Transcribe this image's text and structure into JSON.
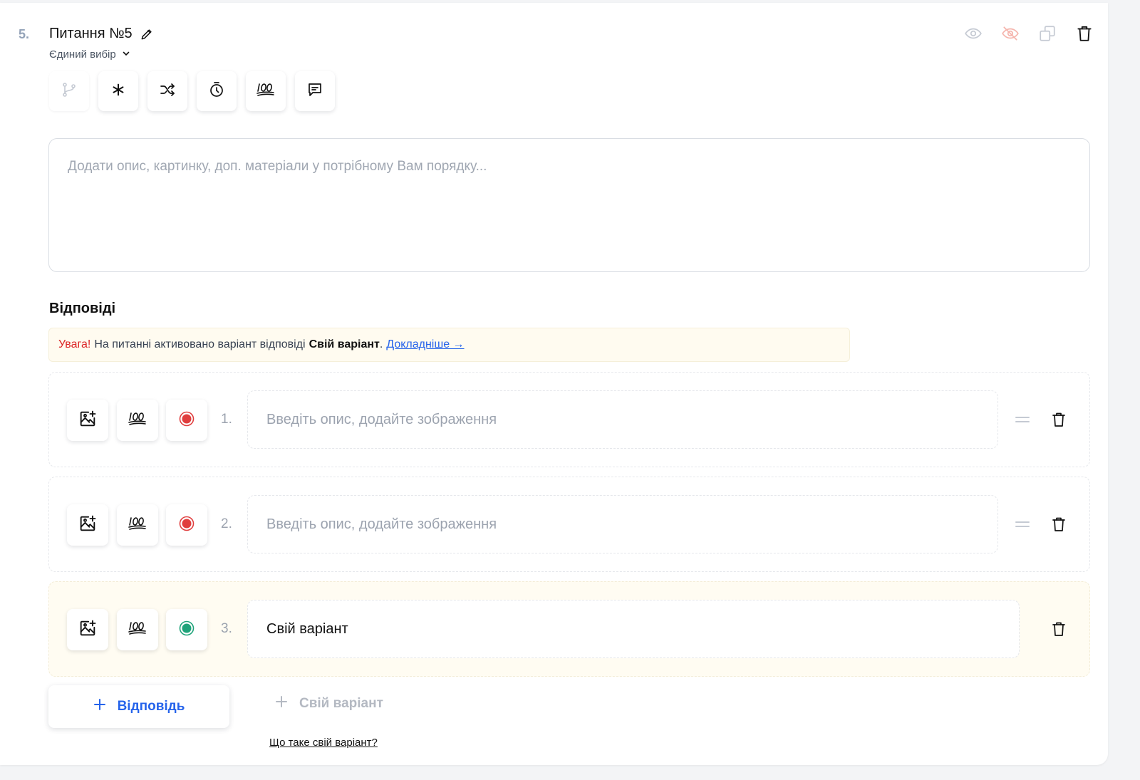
{
  "question": {
    "number": "5.",
    "title": "Питання №5",
    "type_label": "Єдиний вибір"
  },
  "description": {
    "placeholder": "Додати опис, картинку, доп. матеріали у потрібному Вам порядку..."
  },
  "answers_section": {
    "title": "Відповіді"
  },
  "notice": {
    "warning": "Увага!",
    "text": "На питанні активовано варіант відповіді",
    "bold": "Свій варіант",
    "period": ".",
    "link": "Докладніше →"
  },
  "answers": [
    {
      "number": "1.",
      "placeholder": "Введіть опис, додайте зображення",
      "value": ""
    },
    {
      "number": "2.",
      "placeholder": "Введіть опис, додайте зображення",
      "value": ""
    },
    {
      "number": "3.",
      "placeholder": "",
      "value": "Свій варіант"
    }
  ],
  "buttons": {
    "add_answer": "Відповідь",
    "add_custom": "Свій варіант",
    "what_custom": "Що таке свій варіант?"
  },
  "colors": {
    "accent": "#2563eb",
    "warning": "#dc2626",
    "incorrect_dot": "#e03e3e",
    "correct_dot": "#1fa37a",
    "custom_bg": "#fffcf2"
  },
  "icons": {
    "toolbar": [
      "branch-icon",
      "required-asterisk-icon",
      "shuffle-icon",
      "timer-icon",
      "score-100-icon",
      "comment-icon"
    ],
    "header": [
      "eye-icon",
      "eye-off-icon",
      "duplicate-icon",
      "trash-icon"
    ]
  }
}
